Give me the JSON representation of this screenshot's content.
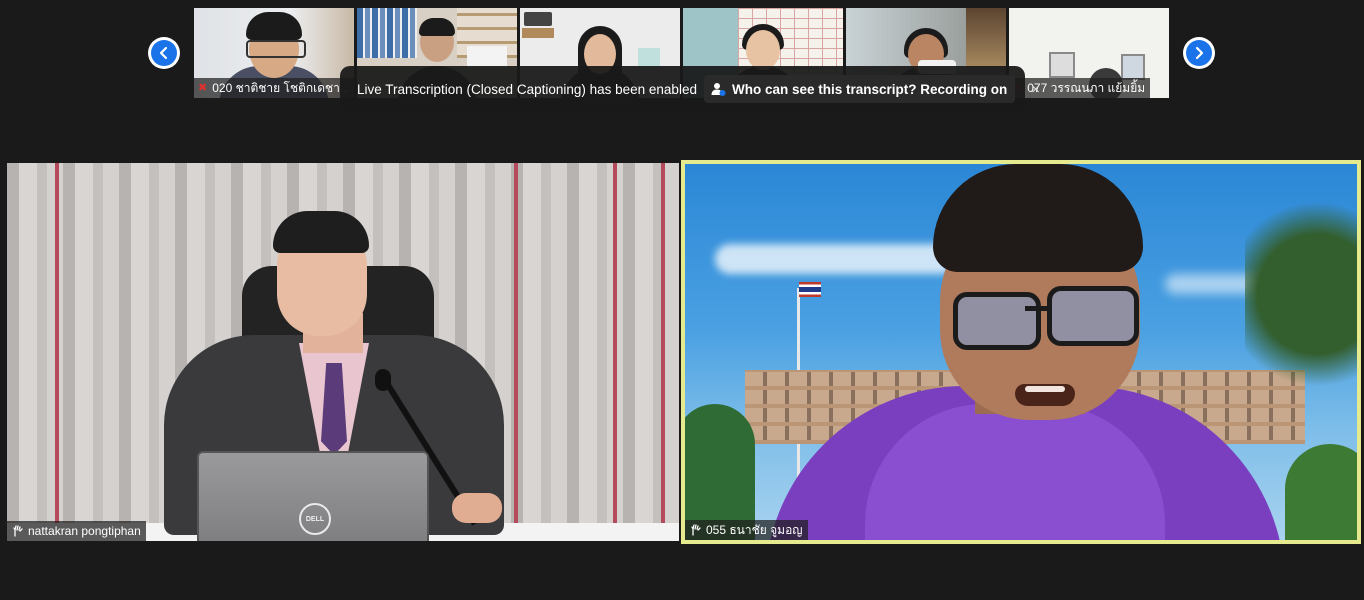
{
  "gallery": {
    "prev_icon": "chevron-left-icon",
    "next_icon": "chevron-right-icon",
    "thumbnails": [
      {
        "name": "020 ชาติชาย โชติกเดชา..."
      },
      {
        "name": ""
      },
      {
        "name": ""
      },
      {
        "name": ""
      },
      {
        "name": ""
      },
      {
        "name": "077 วรรณนภา แย้มยิ้ม"
      }
    ]
  },
  "caption_banner": {
    "message": "Live Transcription (Closed Captioning) has been enabled",
    "link": "Who can see this transcript? Recording on",
    "close": "×"
  },
  "main_videos": {
    "left_participant": "nattakran pongtiphan",
    "right_participant": "055 ธนาชัย จูมอญ",
    "laptop_brand": "DELL"
  },
  "colors": {
    "active_speaker_border": "#e6ea8f",
    "nav_button": "#1a73e8",
    "muted_mic": "#e0312f"
  }
}
